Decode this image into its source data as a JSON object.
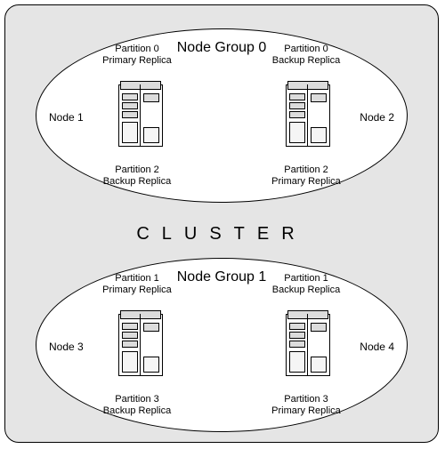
{
  "cluster_label": "CLUSTER",
  "groups": [
    {
      "title": "Node Group 0",
      "node_left": "Node 1",
      "node_right": "Node 2",
      "top_left_line1": "Partition 0",
      "top_left_line2": "Primary Replica",
      "top_right_line1": "Partition 0",
      "top_right_line2": "Backup Replica",
      "bot_left_line1": "Partition 2",
      "bot_left_line2": "Backup Replica",
      "bot_right_line1": "Partition 2",
      "bot_right_line2": "Primary Replica"
    },
    {
      "title": "Node Group 1",
      "node_left": "Node 3",
      "node_right": "Node 4",
      "top_left_line1": "Partition 1",
      "top_left_line2": "Primary Replica",
      "top_right_line1": "Partition 1",
      "top_right_line2": "Backup Replica",
      "bot_left_line1": "Partition 3",
      "bot_left_line2": "Backup Replica",
      "bot_right_line1": "Partition 3",
      "bot_right_line2": "Primary Replica"
    }
  ]
}
